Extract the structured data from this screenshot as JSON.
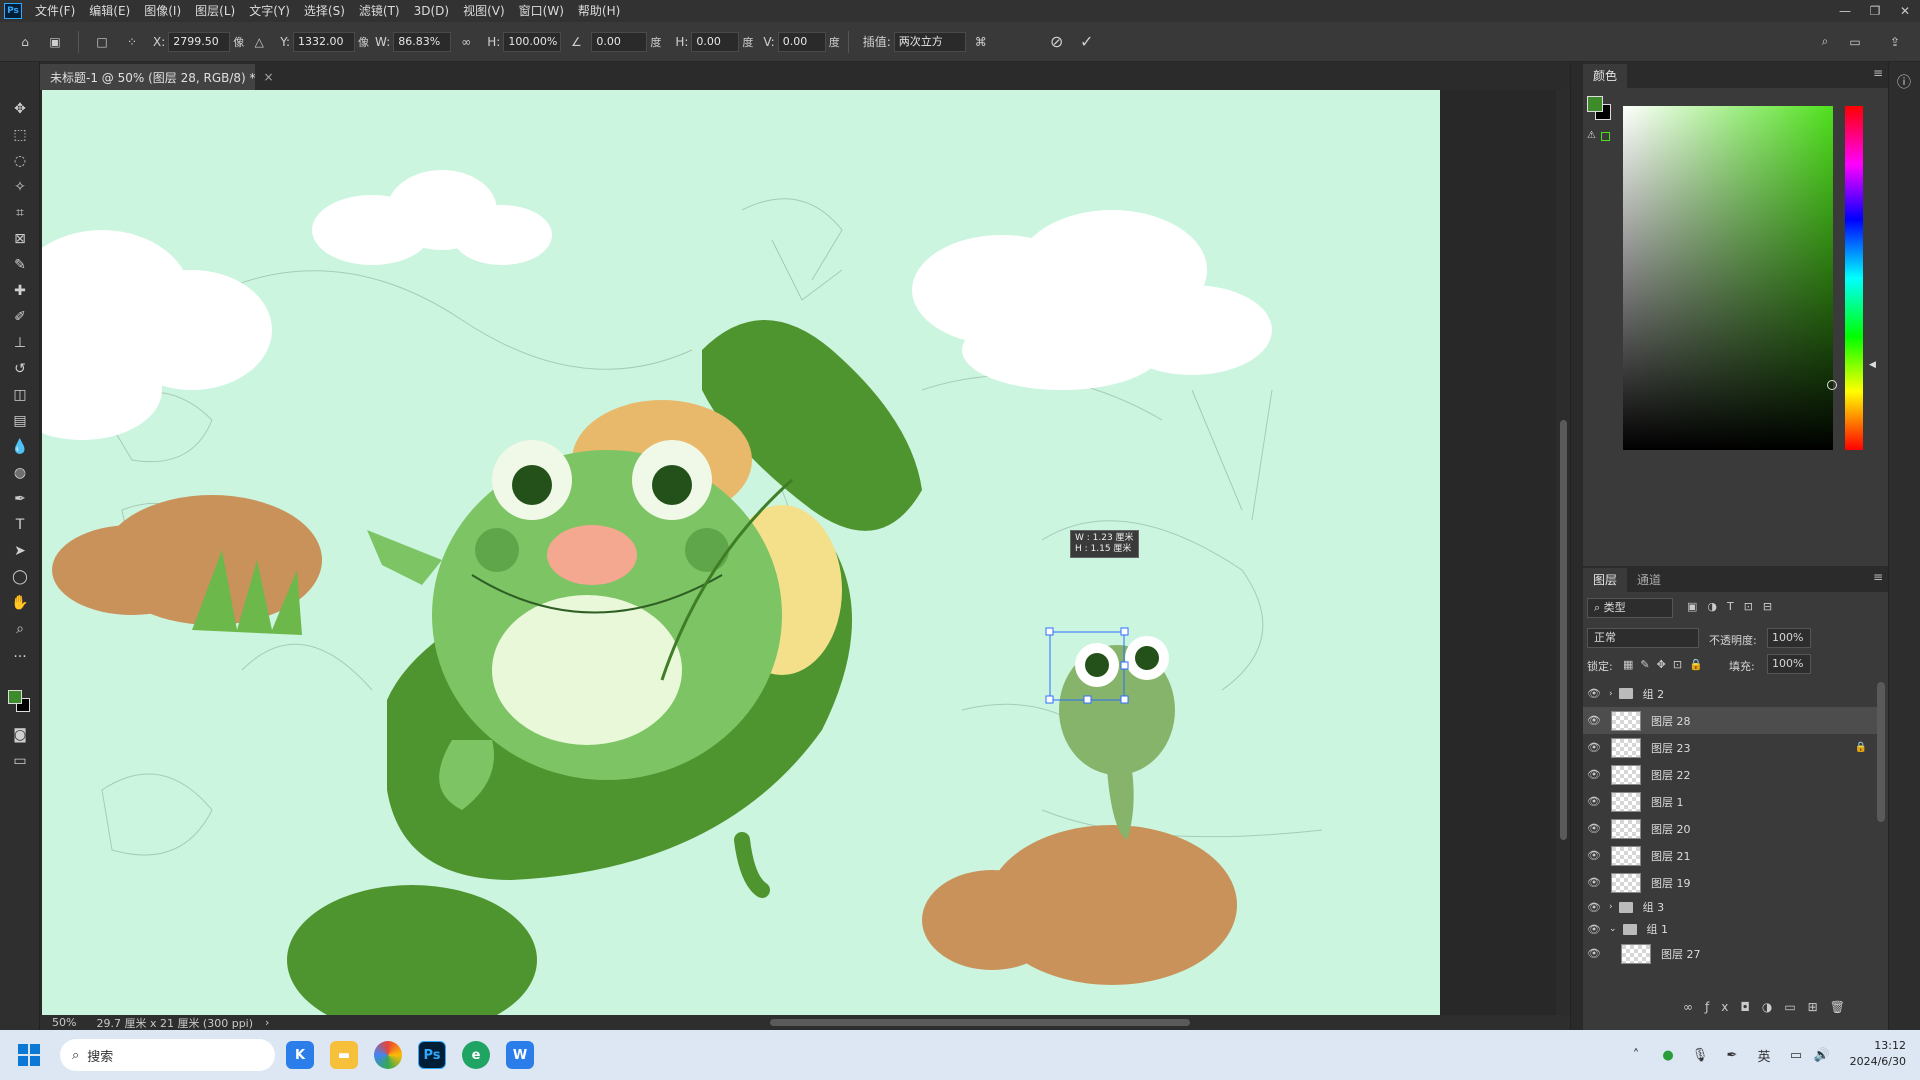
{
  "app": {
    "logo": "Ps",
    "menu": [
      "文件(F)",
      "编辑(E)",
      "图像(I)",
      "图层(L)",
      "文字(Y)",
      "选择(S)",
      "滤镜(T)",
      "3D(D)",
      "视图(V)",
      "窗口(W)",
      "帮助(H)"
    ]
  },
  "options": {
    "x_label": "X:",
    "x_value": "2799.50",
    "x_unit": "像",
    "y_label": "Y:",
    "y_value": "1332.00",
    "y_unit": "像",
    "w_label": "W:",
    "w_value": "86.83%",
    "h_label": "H:",
    "h_value": "100.00%",
    "angle_value": "0.00",
    "angle_unit": "度",
    "hskew_label": "H:",
    "hskew_value": "0.00",
    "hskew_unit": "度",
    "vskew_label": "V:",
    "vskew_value": "0.00",
    "vskew_unit": "度",
    "interp_label": "插值:",
    "interp_value": "两次立方"
  },
  "document": {
    "tab_title": "未标题-1 @ 50% (图层 28, RGB/8) *",
    "tooltip_w": "W : 1.23 厘米",
    "tooltip_h": "H : 1.15 厘米"
  },
  "status": {
    "zoom": "50%",
    "doc_size": "29.7 厘米 x 21 厘米 (300 ppi)"
  },
  "panels": {
    "color_tab": "颜色",
    "layers_tab": "图层",
    "channels_tab": "通道",
    "filter_kind": "类型",
    "blend_mode": "正常",
    "opacity_label": "不透明度:",
    "opacity_value": "100%",
    "lock_label": "锁定:",
    "fill_label": "填充:",
    "fill_value": "100%",
    "fg_color": "#3d8b2a",
    "bg_color": "#000000"
  },
  "layers": [
    {
      "name": "组 2",
      "type": "group"
    },
    {
      "name": "图层 28",
      "type": "layer",
      "selected": true
    },
    {
      "name": "图层 23",
      "type": "layer",
      "locked": true
    },
    {
      "name": "图层 22",
      "type": "layer"
    },
    {
      "name": "图层 1",
      "type": "layer"
    },
    {
      "name": "图层 20",
      "type": "layer"
    },
    {
      "name": "图层 21",
      "type": "layer"
    },
    {
      "name": "图层 19",
      "type": "layer"
    },
    {
      "name": "组 3",
      "type": "group"
    },
    {
      "name": "组 1",
      "type": "group"
    },
    {
      "name": "图层 27",
      "type": "layer"
    }
  ],
  "taskbar": {
    "search_placeholder": "搜索",
    "time": "13:12",
    "date": "2024/6/30",
    "ime": "英",
    "ps_label": "Ps"
  },
  "colors": {
    "canvas_bg": "#cbf5df",
    "frog_body": "#7cc464",
    "frog_belly": "#e8f8d8",
    "leaf_dark": "#4f952f",
    "rock": "#c9925a"
  }
}
